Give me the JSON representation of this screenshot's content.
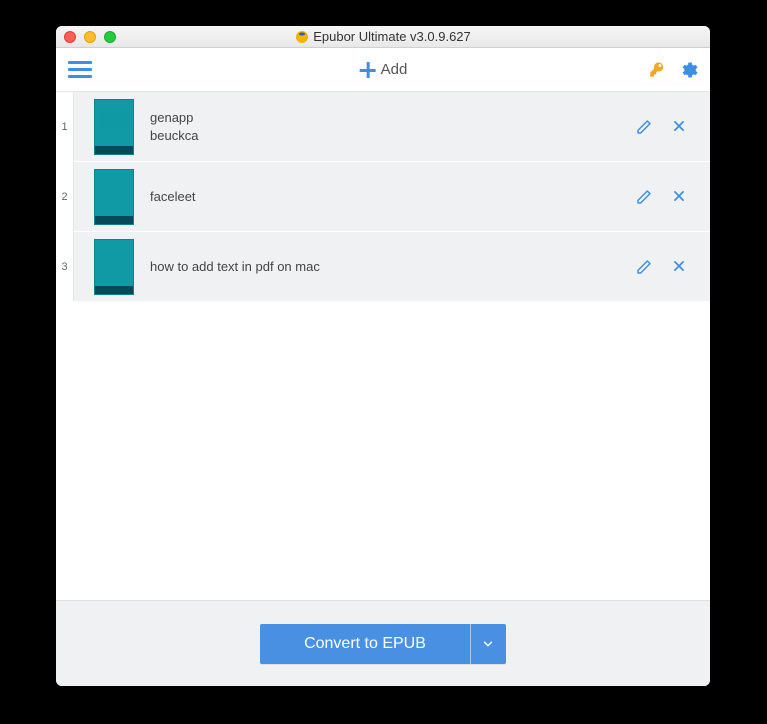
{
  "titlebar": {
    "title": "Epubor Ultimate v3.0.9.627"
  },
  "toolbar": {
    "add_label": "Add"
  },
  "books": [
    {
      "index": "1",
      "title": "genapp",
      "author": "beuckca"
    },
    {
      "index": "2",
      "title": "faceleet",
      "author": ""
    },
    {
      "index": "3",
      "title": "how to add text in pdf on mac",
      "author": ""
    }
  ],
  "footer": {
    "convert_label": "Convert to EPUB"
  }
}
